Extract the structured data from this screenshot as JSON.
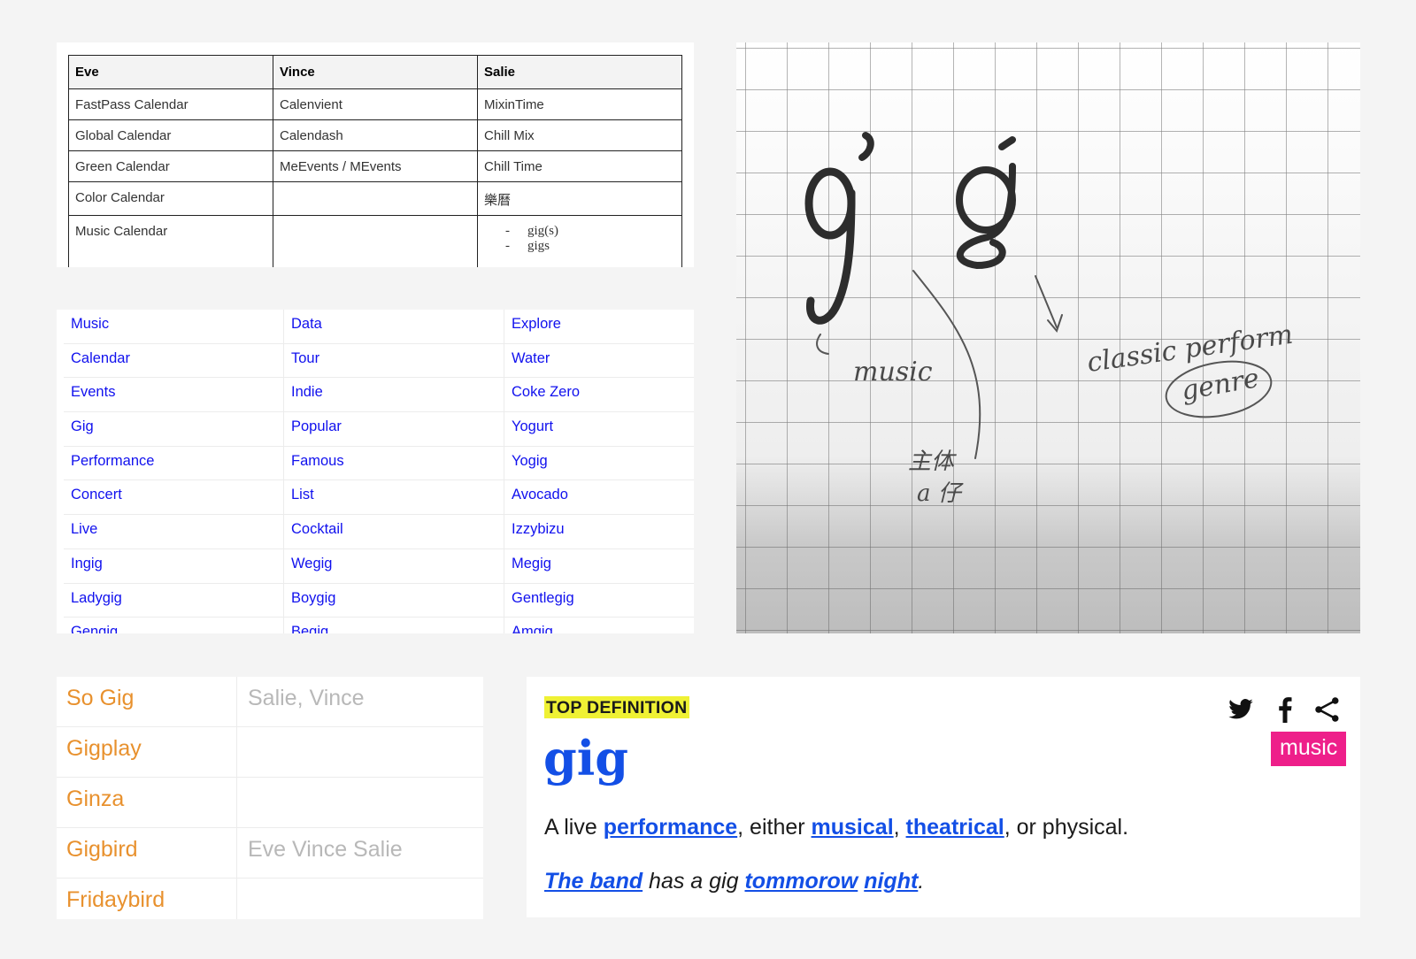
{
  "names_table": {
    "headers": [
      "Eve",
      "Vince",
      "Salie"
    ],
    "rows": [
      [
        "FastPass Calendar",
        "Calenvient",
        "MixinTime"
      ],
      [
        "Global Calendar",
        "Calendash",
        "Chill Mix"
      ],
      [
        "Green Calendar",
        "MeEvents / MEvents",
        "Chill Time"
      ],
      [
        "Color Calendar",
        "",
        "樂曆"
      ],
      [
        "Music Calendar",
        "",
        ""
      ]
    ],
    "last_row_bullets": [
      "gig(s)",
      "gigs"
    ]
  },
  "keyword_grid": [
    [
      "Music",
      "Data",
      "Explore"
    ],
    [
      "Calendar",
      "Tour",
      "Water"
    ],
    [
      "Events",
      "Indie",
      "Coke Zero"
    ],
    [
      "Gig",
      "Popular",
      "Yogurt"
    ],
    [
      "Performance",
      "Famous",
      "Yogig"
    ],
    [
      "Concert",
      "List",
      "Avocado"
    ],
    [
      "Live",
      "Cocktail",
      "Izzybizu"
    ],
    [
      "Ingig",
      "Wegig",
      "Megig"
    ],
    [
      "Ladygig",
      "Boygig",
      "Gentlegig"
    ],
    [
      "Gengig",
      "Begig",
      "Amgig"
    ]
  ],
  "sketch": {
    "letters": [
      "g",
      "g"
    ],
    "notes": [
      "music",
      "classic perform",
      "genre",
      "主体",
      "a 仔"
    ]
  },
  "candidates": [
    {
      "name": "So Gig",
      "voters": "Salie, Vince"
    },
    {
      "name": "Gigplay",
      "voters": ""
    },
    {
      "name": "Ginza",
      "voters": ""
    },
    {
      "name": "Gigbird",
      "voters": "Eve Vince Salie"
    },
    {
      "name": "Fridaybird",
      "voters": ""
    }
  ],
  "definition": {
    "badge": "TOP DEFINITION",
    "word": "gig",
    "tag": "music",
    "meaning": {
      "p1": "A live ",
      "l1": "performance",
      "p2": ", either ",
      "l2": "musical",
      "p3": ", ",
      "l3": "theatrical",
      "p4": ", or physical."
    },
    "example": {
      "l1": "The band",
      "p1": " has a gig ",
      "l2": "tommorow",
      "p2": " ",
      "l3": "night",
      "p3": "."
    },
    "share_icons": [
      "twitter-icon",
      "facebook-icon",
      "share-icon"
    ],
    "colors": {
      "word": "#134fe6",
      "badge_bg": "#eff134",
      "tag_bg": "#ee1f8a"
    }
  },
  "colors": {
    "keyword_link": "#1111ee",
    "candidate_name": "#e8912e",
    "candidate_voters": "#b8b8b8"
  }
}
